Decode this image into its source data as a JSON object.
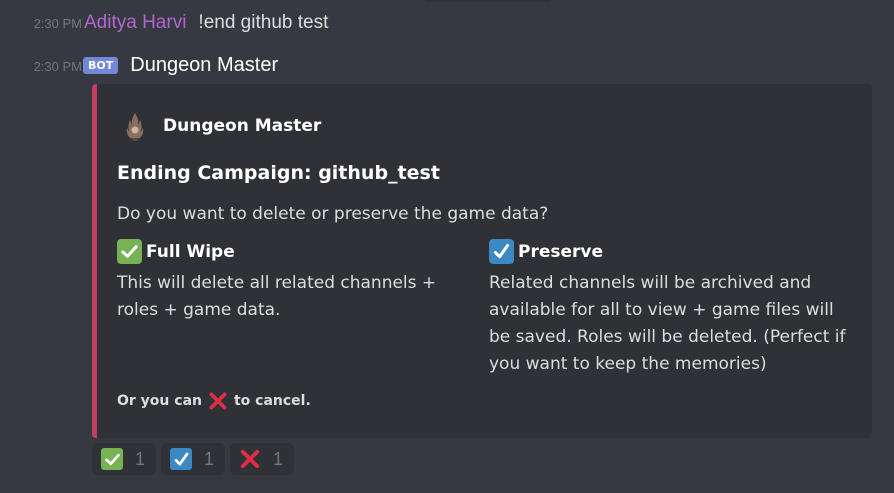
{
  "messages": {
    "user": {
      "timestamp": "2:30 PM",
      "author": "Aditya Harvi",
      "text": "!end github test"
    },
    "bot": {
      "timestamp": "2:30 PM",
      "tag": "BOT",
      "author": "Dungeon Master"
    }
  },
  "embed": {
    "accent_color": "#c43c5e",
    "author_name": "Dungeon Master",
    "author_icon": "dungeon-master-avatar-icon",
    "title": "Ending Campaign: github_test",
    "description": "Do you want to delete or preserve the game data?",
    "fields": {
      "full_wipe": {
        "icon": "white-check-mark-icon",
        "name": "Full Wipe",
        "value_lines": [
          "This will delete all related channels +",
          "roles + game data."
        ]
      },
      "preserve": {
        "icon": "ballot-box-check-icon",
        "name": "Preserve",
        "value_lines": [
          "Related channels will be archived and",
          "available for all to view + game files will",
          "be saved. Roles will be deleted. (Perfect if",
          "you want to keep the memories)"
        ]
      }
    },
    "footer": {
      "before": "Or you can",
      "icon": "cross-mark-icon",
      "after": "to cancel."
    }
  },
  "reactions": [
    {
      "icon": "white-check-mark-icon",
      "count": "1"
    },
    {
      "icon": "ballot-box-check-icon",
      "count": "1"
    },
    {
      "icon": "cross-mark-icon",
      "count": "1"
    }
  ],
  "colors": {
    "background": "#36393f",
    "embed_background": "#2f3136",
    "user_name": "#b166d4",
    "bot_tag": "#7289da",
    "check_green": "#77b255",
    "check_blue": "#3b88c3",
    "cross_red": "#dd2e44"
  }
}
